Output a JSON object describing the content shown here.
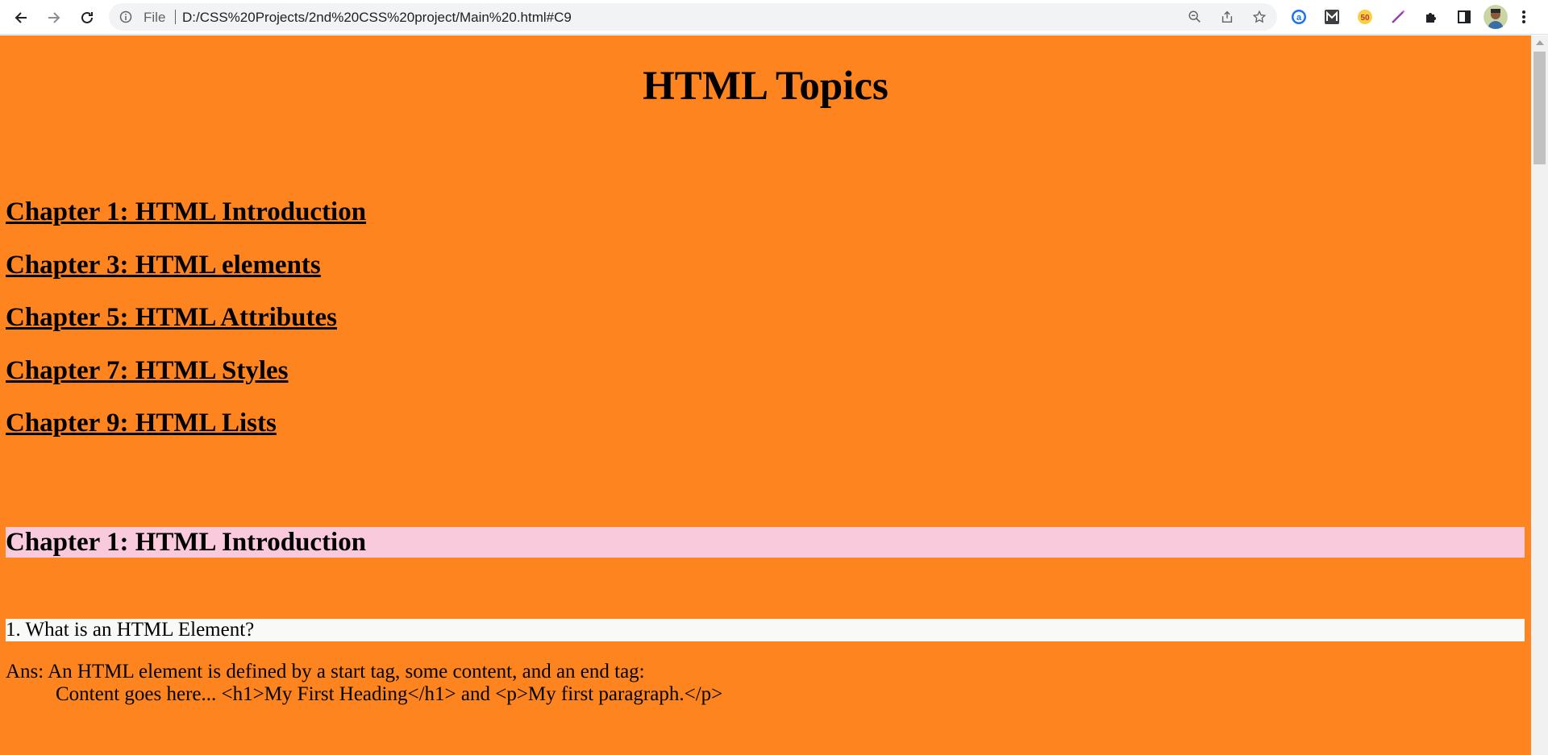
{
  "browser": {
    "omnibox": {
      "scheme_label": "File",
      "url": "D:/CSS%20Projects/2nd%20CSS%20project/Main%20.html#C9"
    },
    "icons": {
      "back": "arrow-left-icon",
      "forward": "arrow-right-icon",
      "reload": "reload-icon",
      "info": "info-icon",
      "zoom": "zoom-out-icon",
      "share": "share-icon",
      "bookmark": "star-icon",
      "extensions": [
        "a-extension-icon",
        "m-extension-icon",
        "fifty-extension-icon",
        "pen-extension-icon",
        "puzzle-icon",
        "side-panel-icon",
        "profile-avatar",
        "kebab-menu-icon"
      ]
    }
  },
  "page": {
    "background": "#fd841f",
    "title": "HTML Topics",
    "toc": [
      "Chapter 1: HTML Introduction",
      "Chapter 3: HTML elements",
      "Chapter 5: HTML Attributes",
      "Chapter 7: HTML Styles",
      "Chapter 9: HTML Lists"
    ],
    "section": {
      "heading": "Chapter 1: HTML Introduction",
      "heading_bg": "#f9c9dc",
      "question": "1. What is an HTML Element?",
      "answer_line1": "Ans: An HTML element is defined by a start tag, some content, and an end tag:",
      "answer_line2": "Content goes here... <h1>My First Heading</h1> and <p>My first paragraph.</p>"
    }
  }
}
